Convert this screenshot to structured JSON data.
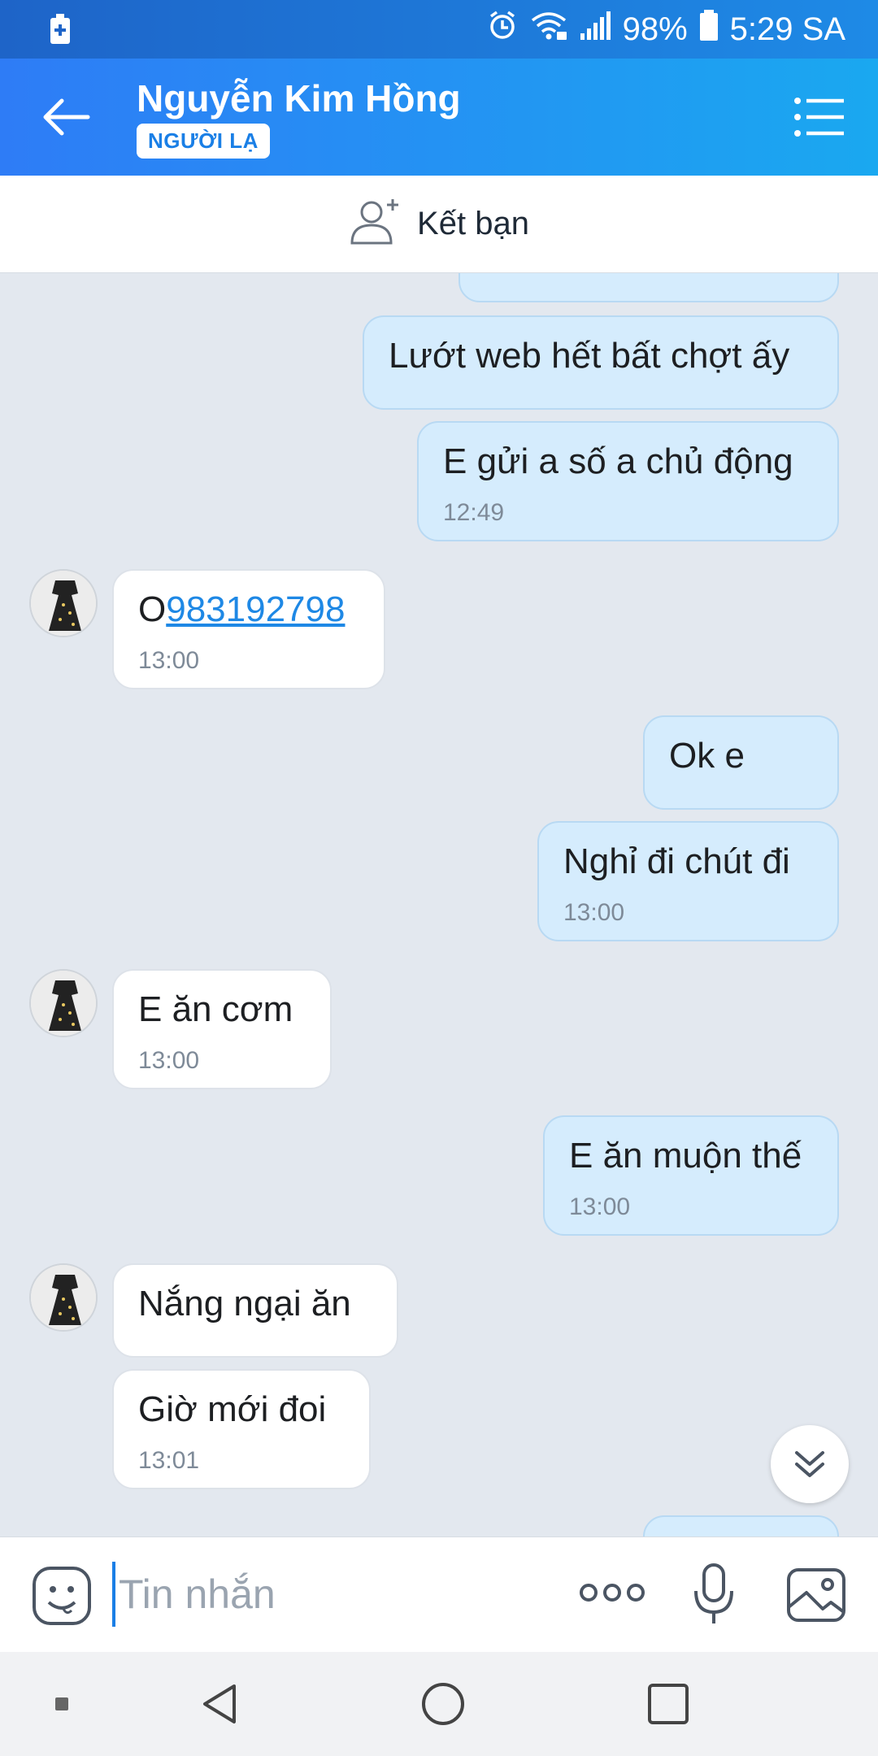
{
  "status_bar": {
    "battery_percent": "98%",
    "time": "5:29 SA"
  },
  "header": {
    "contact_name": "Nguyễn Kim Hồng",
    "badge": "NGƯỜI LẠ"
  },
  "add_friend": {
    "label": "Kết bạn"
  },
  "messages": [
    {
      "side": "out",
      "text": "Lướt web hết bất chợt ấy"
    },
    {
      "side": "out",
      "text": "E gửi a số a chủ động",
      "time": "12:49"
    },
    {
      "side": "in",
      "prefix": "O",
      "link": "983192798",
      "time": "13:00"
    },
    {
      "side": "out",
      "text": "Ok e"
    },
    {
      "side": "out",
      "text": "Nghỉ đi chút đi",
      "time": "13:00"
    },
    {
      "side": "in",
      "text": "E ăn cơm",
      "time": "13:00"
    },
    {
      "side": "out",
      "text": "E ăn muộn thế",
      "time": "13:00"
    },
    {
      "side": "in",
      "text": "Nắng ngại ăn"
    },
    {
      "side": "in",
      "text": "Giờ mới đoi",
      "time": "13:01"
    }
  ],
  "composer": {
    "placeholder": "Tin nhắn"
  },
  "colors": {
    "header_start": "#2e7cf6",
    "header_end": "#1aa8f0",
    "bubble_out": "#d5ecfd",
    "bubble_in": "#ffffff",
    "link": "#1e88e5"
  }
}
